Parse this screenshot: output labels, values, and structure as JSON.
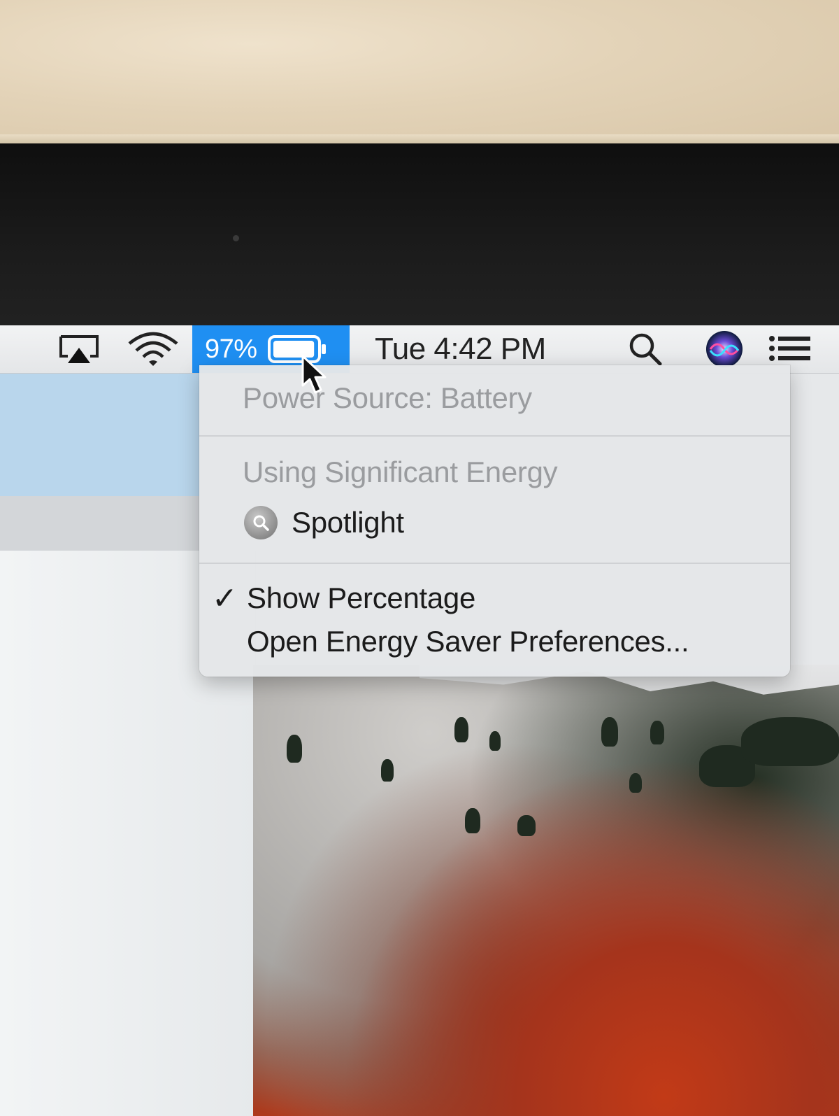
{
  "menubar": {
    "battery_percent": "97%",
    "battery_level": 0.97,
    "clock": "Tue 4:42 PM",
    "accent_color": "#1f8ff2",
    "icons": [
      "airplay-icon",
      "wifi-icon",
      "battery-icon",
      "search-icon",
      "siri-icon",
      "notification-center-icon"
    ]
  },
  "battery_menu": {
    "power_source": "Power Source: Battery",
    "energy_header": "Using Significant Energy",
    "energy_apps": [
      {
        "name": "Spotlight",
        "icon": "spotlight-icon"
      }
    ],
    "show_percentage": {
      "label": "Show Percentage",
      "checked": true,
      "check_mark": "✓"
    },
    "open_prefs": "Open Energy Saver Preferences..."
  }
}
